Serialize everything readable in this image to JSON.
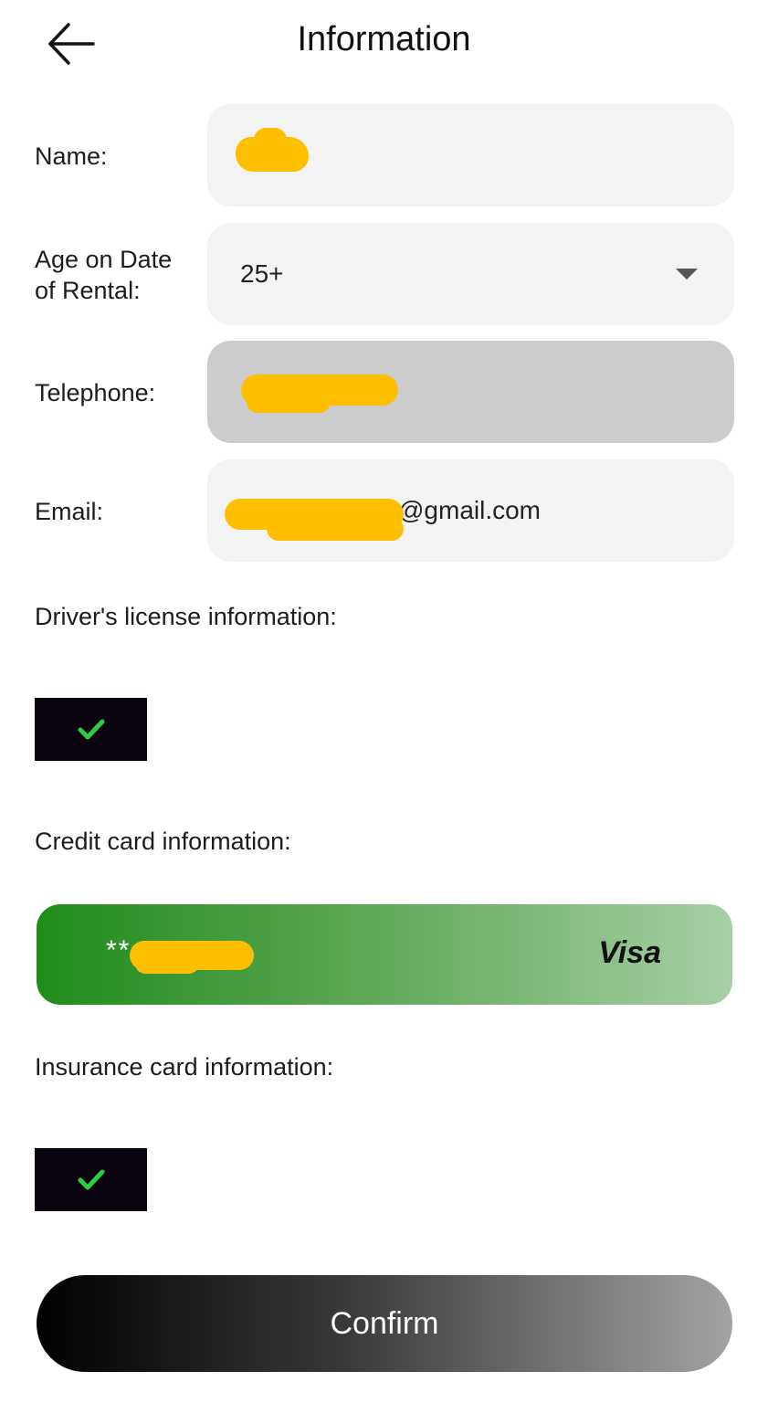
{
  "header": {
    "title": "Information",
    "back_icon": "arrow-left-icon"
  },
  "form": {
    "name": {
      "label": "Name:",
      "value": ""
    },
    "age": {
      "label_line1": "Age on Date",
      "label_line2": "of Rental:",
      "value": "25+",
      "icon": "caret-down-icon"
    },
    "telephone": {
      "label": "Telephone:",
      "value": ""
    },
    "email": {
      "label": "Email:",
      "value": "@gmail.com"
    }
  },
  "drivers_license": {
    "label": "Driver's license information:",
    "status_icon": "check-icon"
  },
  "credit_card": {
    "label": "Credit card information:",
    "masked_number": "**",
    "brand": "Visa"
  },
  "insurance_card": {
    "label": "Insurance card information:",
    "status_icon": "check-icon"
  },
  "confirm_label": "Confirm",
  "colors": {
    "redaction": "#ffbf00",
    "check": "#2ecc40",
    "card_gradient_start": "#1f8c1a",
    "card_gradient_end": "#a7cfa5"
  }
}
